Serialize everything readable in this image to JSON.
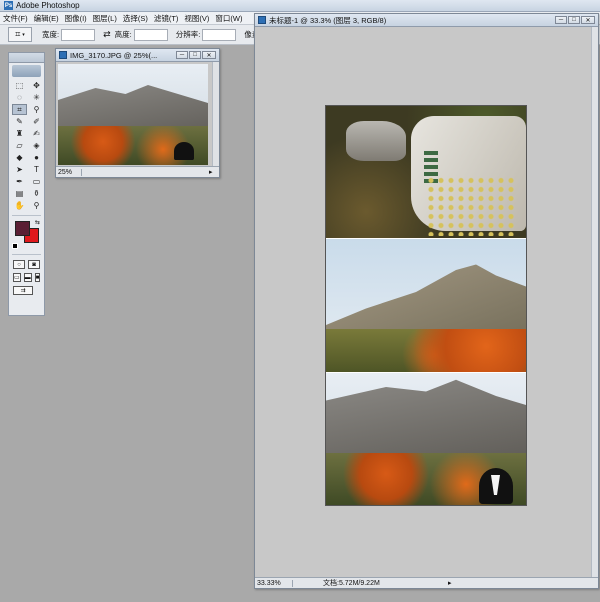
{
  "app": {
    "title": "Adobe Photoshop",
    "logo": "Ps"
  },
  "menu": [
    "文件(F)",
    "编辑(E)",
    "图像(I)",
    "图层(L)",
    "选择(S)",
    "滤镜(T)",
    "视图(V)",
    "窗口(W)"
  ],
  "options": {
    "tool_icon": "crop-icon",
    "width_label": "宽度:",
    "swap_symbol": "⇄",
    "height_label": "高度:",
    "resolution_label": "分辨率:",
    "unit_label": "像素/"
  },
  "small_doc": {
    "title": "IMG_3170.JPG @ 25%(...",
    "zoom": "25%",
    "btn_min": "─",
    "btn_max": "□",
    "btn_close": "✕"
  },
  "main_doc": {
    "title": "未标题-1 @ 33.3% (图层 3, RGB/8)",
    "zoom": "33.33%",
    "doc_info": "文档:5.72M/9.22M",
    "btn_min": "─",
    "btn_max": "□",
    "btn_close": "✕"
  },
  "colors": {
    "foreground": "#5a1f34",
    "background": "#e0181c"
  },
  "tools": [
    {
      "name": "marquee-tool",
      "glyph": "⬚"
    },
    {
      "name": "move-tool",
      "glyph": "✥"
    },
    {
      "name": "lasso-tool",
      "glyph": "◌"
    },
    {
      "name": "magic-wand-tool",
      "glyph": "✳"
    },
    {
      "name": "crop-tool",
      "glyph": "⌗"
    },
    {
      "name": "eyedropper-tool",
      "glyph": "⚲"
    },
    {
      "name": "healing-brush-tool",
      "glyph": "✎"
    },
    {
      "name": "brush-tool",
      "glyph": "✐"
    },
    {
      "name": "stamp-tool",
      "glyph": "♜"
    },
    {
      "name": "history-brush-tool",
      "glyph": "✍"
    },
    {
      "name": "eraser-tool",
      "glyph": "▱"
    },
    {
      "name": "paint-bucket-tool",
      "glyph": "◈"
    },
    {
      "name": "blur-tool",
      "glyph": "◆"
    },
    {
      "name": "dodge-tool",
      "glyph": "●"
    },
    {
      "name": "path-selection-tool",
      "glyph": "➤"
    },
    {
      "name": "type-tool",
      "glyph": "T"
    },
    {
      "name": "pen-tool",
      "glyph": "✒"
    },
    {
      "name": "shape-tool",
      "glyph": "▭"
    },
    {
      "name": "notes-tool",
      "glyph": "▤"
    },
    {
      "name": "eyedropper2-tool",
      "glyph": "⚱"
    },
    {
      "name": "hand-tool",
      "glyph": "✋"
    },
    {
      "name": "zoom-tool",
      "glyph": "⚲"
    }
  ]
}
